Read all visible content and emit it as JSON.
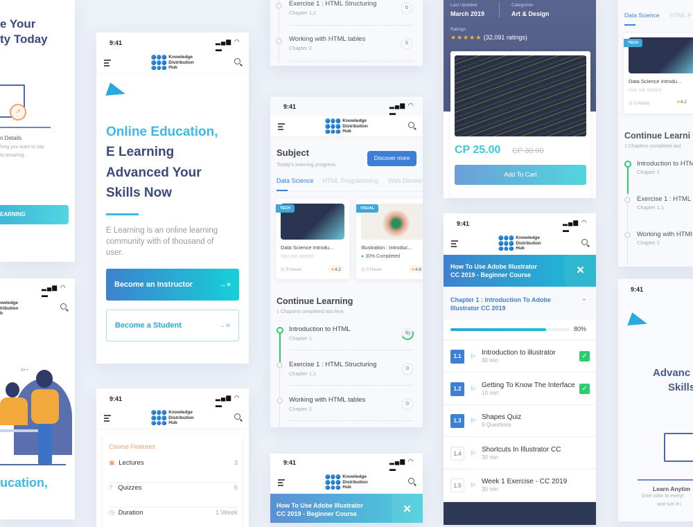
{
  "status_time": "9:41",
  "logo": {
    "line1": "Knowledge",
    "line2": "Distribution",
    "line3": "Hub"
  },
  "left_top": {
    "title1": "e Your",
    "title2": "ty Today",
    "subtitle": "n Details",
    "desc1": "hing you want to say",
    "desc2": "to amazing...",
    "button": "EARNING"
  },
  "left_bottom": {
    "logo1": "owledge",
    "logo2": "tribution",
    "logo3": "b",
    "grade": "A++",
    "headline": "ucation,"
  },
  "hero": {
    "line1": "Online Education,",
    "line2": "E Learning",
    "line3": "Advanced Your",
    "line4": "Skills Now",
    "description": "E Learning is an online learning community with of thousand of user.",
    "instructor_button": "Become an Instructor",
    "student_button": "Become a Student"
  },
  "features": {
    "title": "Course Features",
    "rows": [
      {
        "label": "Lectures",
        "value": "3"
      },
      {
        "label": "Quizzes",
        "value": "5"
      },
      {
        "label": "Duration",
        "value": "1 Week"
      }
    ]
  },
  "continue": {
    "title": "Continue Learning",
    "subtitle": "1 Chapters completed last time.",
    "items": [
      {
        "title": "Introduction to HTML",
        "chapter": "Chapter 1",
        "progress": "60"
      },
      {
        "title": "Exercise 1 : HTML Structuring",
        "chapter": "Chapter 1,1",
        "progress": "0"
      },
      {
        "title": "Working with HTML tables",
        "chapter": "Chapter 2",
        "progress": "0"
      }
    ]
  },
  "subject": {
    "title": "Subject",
    "subtitle": "Today's learning progress",
    "discover": "Discover more",
    "tabs": [
      "Data Science",
      "HTML Programming",
      "Web Develo"
    ],
    "cards": [
      {
        "tag": "TECH",
        "title": "Data Science Introdu...",
        "status": "Has not started",
        "hours": "3 Hours",
        "rating": "4.2"
      },
      {
        "tag": "VISUAL",
        "title": "Illustration : Introduc...",
        "status": "30% Completed",
        "hours": "3 Hours",
        "rating": "4.8"
      }
    ]
  },
  "course_detail": {
    "last_updated_label": "Last Updated",
    "last_updated": "March 2019",
    "categories_label": "Categories",
    "category": "Art & Design",
    "ratings_label": "Ratings",
    "stars": 5,
    "ratings": "(32,091 ratings)",
    "price": "CP 25.00",
    "old_price": "CP 30.00",
    "cart": "Add To Cart"
  },
  "course": {
    "title1": "How To Use Adobe Illustrator",
    "title2": "CC 2019 - Beginner Course",
    "chapter1": "Chapter 1 : Introduction To Adobe",
    "chapter2": "Illustrator CC 2019",
    "progress": 80,
    "progress_label": "80%",
    "lessons": [
      {
        "num": "1.1",
        "title": "Introduction to illustrator",
        "sub": "30 min",
        "done": true
      },
      {
        "num": "1.2",
        "title": "Getting To Know The Interface",
        "sub": "10 min",
        "done": true
      },
      {
        "num": "1.3",
        "title": "Shapes Quiz",
        "sub": "9 Questions",
        "done": false
      },
      {
        "num": "1.4",
        "title": "Shortcuts In Illustrator CC",
        "sub": "30 min",
        "done": false
      },
      {
        "num": "1.5",
        "title": "Week 1 Exercise - CC 2019",
        "sub": "30 min",
        "done": false
      }
    ]
  },
  "right_top": {
    "tab1": "Data Science",
    "tab2": "HTML P",
    "card_tag": "TECH",
    "card_title": "Data Science Introdu...",
    "card_status": "Has not started",
    "card_hours": "3 Hours",
    "card_rating": "4.2",
    "cl_title": "Continue Learni",
    "cl_sub": "1 Chapters completed last",
    "i1": "Introduction to HTM",
    "i1c": "Chapter 1",
    "i2": "Exercise 1 : HTML",
    "i2c": "Chapter 1,1",
    "i3": "Working with HTMI",
    "i3c": "Chapter 2"
  },
  "right_bottom": {
    "line1": "Advanc",
    "line2": "Skills",
    "learn": "Learn Anytim",
    "desc1": "Give color to everyt",
    "desc2": "and turn it i"
  },
  "colors": {
    "accent": "#3d7fd6",
    "cyan": "#3cb8ea",
    "navy": "#3a4a7a",
    "success": "#2ecc71",
    "orange": "#f3a06a"
  }
}
